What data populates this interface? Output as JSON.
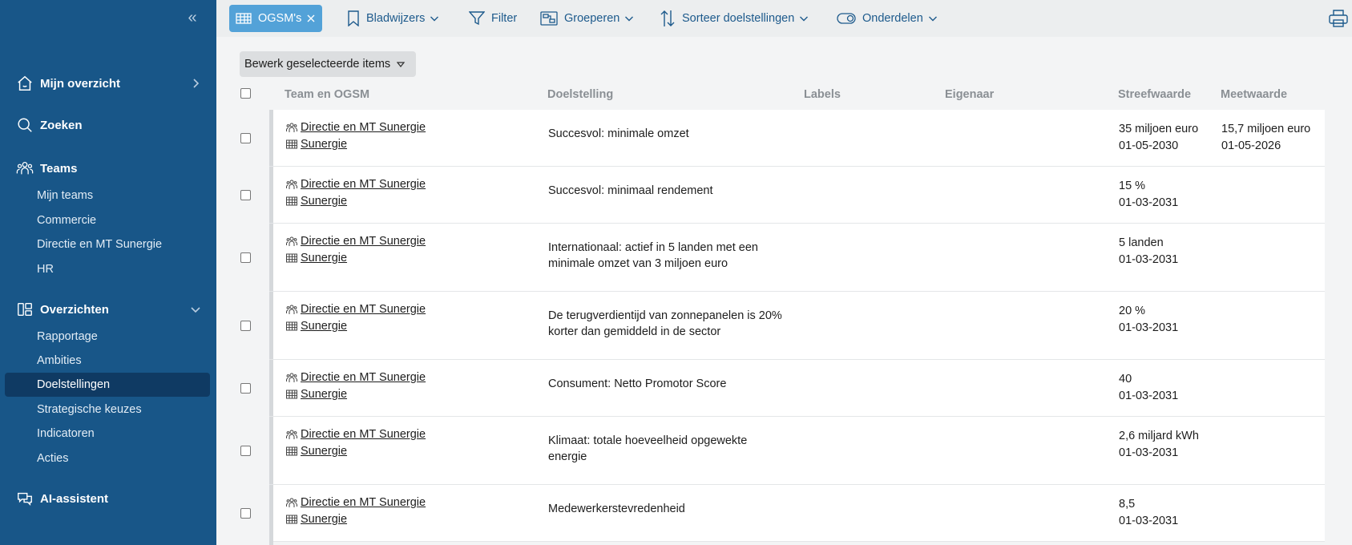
{
  "sidebar": {
    "main": [
      {
        "label": "Mijn overzicht",
        "icon": "home-icon"
      },
      {
        "label": "Zoeken",
        "icon": "search-icon"
      },
      {
        "label": "Teams",
        "icon": "team-icon"
      },
      {
        "label": "Overzichten",
        "icon": "overview-icon"
      },
      {
        "label": "AI-assistent",
        "icon": "chat-icon"
      }
    ],
    "teams": [
      "Mijn teams",
      "Commercie",
      "Directie en MT Sunergie",
      "HR"
    ],
    "overviews": [
      "Rapportage",
      "Ambities",
      "Doelstellingen",
      "Strategische keuzes",
      "Indicatoren",
      "Acties"
    ],
    "active": "Doelstellingen"
  },
  "toolbar": {
    "chip_label": "OGSM's",
    "bookmarks": "Bladwijzers",
    "filter": "Filter",
    "group": "Groeperen",
    "sort": "Sorteer doelstellingen",
    "parts": "Onderdelen"
  },
  "bulk_edit_label": "Bewerk geselecteerde items",
  "table": {
    "headers": [
      "Team en OGSM",
      "Doelstelling",
      "Labels",
      "Eigenaar",
      "Streefwaarde",
      "Meetwaarde"
    ],
    "rows": [
      {
        "team": "Directie en MT Sunergie",
        "ogsm": "Sunergie",
        "goal": "Succesvol: minimale omzet",
        "target": "35 miljoen euro",
        "target_date": "01-05-2030",
        "measure": "15,7 miljoen euro",
        "measure_date": "01-05-2026"
      },
      {
        "team": "Directie en MT Sunergie",
        "ogsm": "Sunergie",
        "goal": "Succesvol: minimaal rendement",
        "target": "15 %",
        "target_date": "01-03-2031",
        "measure": "",
        "measure_date": ""
      },
      {
        "team": "Directie en MT Sunergie",
        "ogsm": "Sunergie",
        "goal": "Internationaal: actief in 5 landen met een minimale omzet van 3 miljoen euro",
        "target": "5 landen",
        "target_date": "01-03-2031",
        "measure": "",
        "measure_date": ""
      },
      {
        "team": "Directie en MT Sunergie",
        "ogsm": "Sunergie",
        "goal": "De terugverdientijd van zonnepanelen is 20% korter dan gemiddeld in de sector",
        "target": "20 %",
        "target_date": "01-03-2031",
        "measure": "",
        "measure_date": ""
      },
      {
        "team": "Directie en MT Sunergie",
        "ogsm": "Sunergie",
        "goal": "Consument: Netto Promotor Score",
        "target": "40",
        "target_date": "01-03-2031",
        "measure": "",
        "measure_date": ""
      },
      {
        "team": "Directie en MT Sunergie",
        "ogsm": "Sunergie",
        "goal": "Klimaat: totale hoeveelheid opgewekte energie",
        "target": "2,6 miljard kWh",
        "target_date": "01-03-2031",
        "measure": "",
        "measure_date": ""
      },
      {
        "team": "Directie en MT Sunergie",
        "ogsm": "Sunergie",
        "goal": "Medewerkerstevredenheid",
        "target": "8,5",
        "target_date": "01-03-2031",
        "measure": "",
        "measure_date": ""
      }
    ]
  }
}
